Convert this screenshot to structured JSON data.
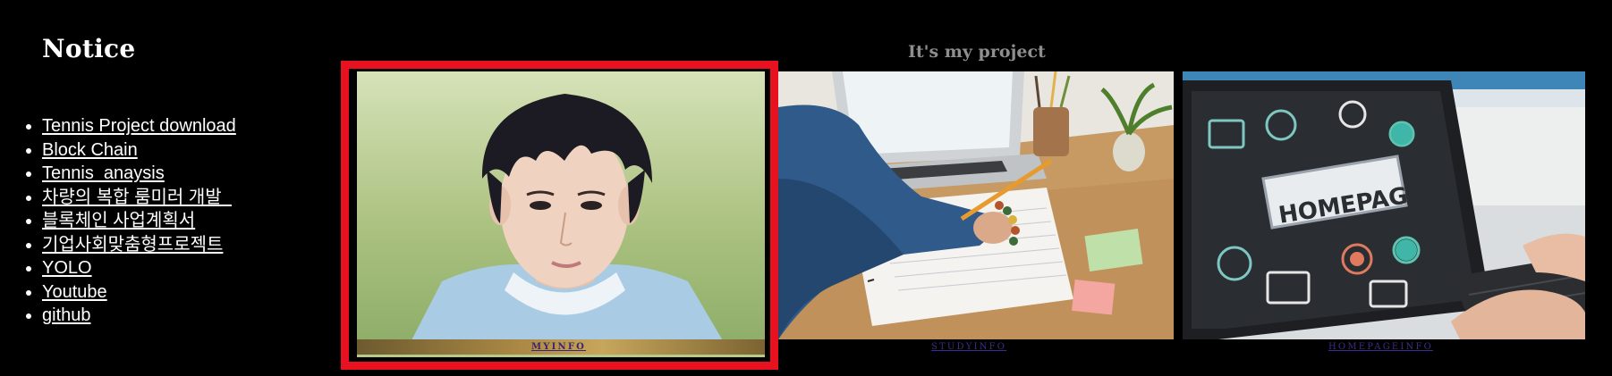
{
  "sidebar": {
    "title": "Notice",
    "links": [
      {
        "label": "Tennis Project download"
      },
      {
        "label": "Block Chain"
      },
      {
        "label": "Tennis_anaysis"
      },
      {
        "label": "차량의 복합 룸미러 개발_"
      },
      {
        "label": "블록체인 사업계획서"
      },
      {
        "label": "기업사회맞춤형프로젝트"
      },
      {
        "label": "YOLO"
      },
      {
        "label": "Youtube"
      },
      {
        "label": "github"
      }
    ]
  },
  "main": {
    "heading": "It's my project",
    "cards": [
      {
        "caption": "MYINFO",
        "image": "portrait-photo",
        "selected": true,
        "highlight_color": "#e8111f"
      },
      {
        "caption": "STUDYINFO",
        "image": "studying-desk-photo"
      },
      {
        "caption": "HOMEPAGEINFO",
        "image": "homepage-laptop-photo"
      }
    ]
  },
  "colors": {
    "background": "#000000",
    "text": "#ffffff",
    "heading_gray": "#8e8e8e",
    "caption_link": "#3f2b8a",
    "selection_border": "#e8111f"
  }
}
